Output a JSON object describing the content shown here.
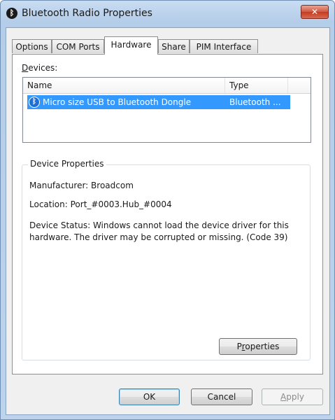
{
  "window": {
    "title": "Bluetooth Radio Properties",
    "icon": "bluetooth-icon",
    "close_label": "✕"
  },
  "tabs": [
    {
      "label": "Options",
      "active": false
    },
    {
      "label": "COM Ports",
      "active": false
    },
    {
      "label": "Hardware",
      "active": true
    },
    {
      "label": "Share",
      "active": false
    },
    {
      "label": "PIM Interface",
      "active": false
    }
  ],
  "hardware": {
    "devices_label_first": "D",
    "devices_label_rest": "evices:",
    "columns": {
      "name": "Name",
      "type": "Type"
    },
    "devices": [
      {
        "name": "Micro size USB to Bluetooth Dongle",
        "type": "Bluetooth ...",
        "icon": "bluetooth-icon",
        "selected": true
      }
    ],
    "device_properties": {
      "title": "Device Properties",
      "manufacturer": "Manufacturer: Broadcom",
      "location": "Location: Port_#0003.Hub_#0004",
      "status": "Device Status: Windows cannot load the device driver for this hardware. The driver may be corrupted or missing. (Code 39)"
    },
    "properties_button": {
      "prefix": "P",
      "underlined": "r",
      "suffix": "operties"
    }
  },
  "footer": {
    "ok": "OK",
    "cancel": "Cancel",
    "apply_underlined": "A",
    "apply_rest": "pply"
  },
  "colors": {
    "selection": "#3399ff",
    "title_bar": "#c9dcf1",
    "close_button": "#c23a22"
  }
}
